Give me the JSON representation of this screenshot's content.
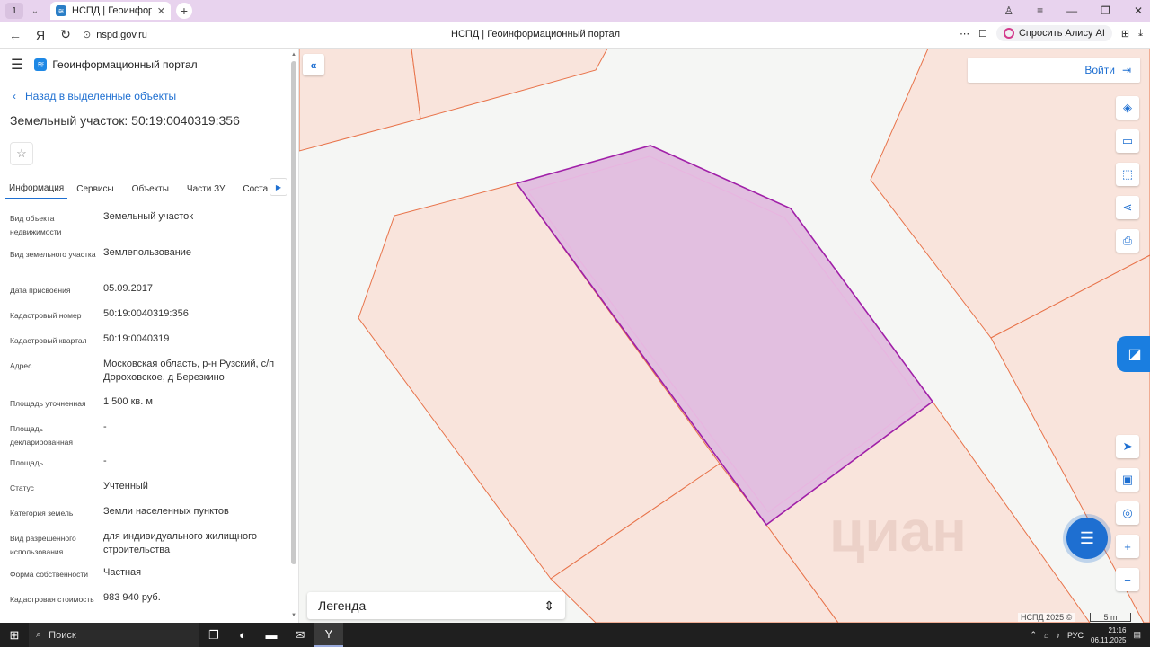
{
  "browser": {
    "tab_count": "1",
    "tab_title": "НСПД | Геоинформацио",
    "url": "nspd.gov.ru",
    "page_title": "НСПД | Геоинформационный портал",
    "alisa_label": "Спросить Алису AI"
  },
  "panel": {
    "portal_name": "Геоинформационный портал",
    "back_link": "Назад в выделенные объекты",
    "object_title": "Земельный участок: 50:19:0040319:356",
    "tabs": [
      "Информация",
      "Сервисы",
      "Объекты",
      "Части ЗУ",
      "Соста"
    ],
    "properties": [
      {
        "key": "Вид объекта недвижимости",
        "value": "Земельный участок"
      },
      {
        "key": "Вид земельного участка",
        "value": "Землепользование"
      },
      {
        "key": "Дата присвоения",
        "value": "05.09.2017"
      },
      {
        "key": "Кадастровый номер",
        "value": "50:19:0040319:356"
      },
      {
        "key": "Кадастровый квартал",
        "value": "50:19:0040319"
      },
      {
        "key": "Адрес",
        "value": "Московская область, р-н Рузский, с/п Дороховское, д Березкино"
      },
      {
        "key": "Площадь уточненная",
        "value": "1 500 кв. м"
      },
      {
        "key": "Площадь декларированная",
        "value": "-"
      },
      {
        "key": "Площадь",
        "value": "-"
      },
      {
        "key": "Статус",
        "value": "Учтенный"
      },
      {
        "key": "Категория земель",
        "value": "Земли населенных пунктов"
      },
      {
        "key": "Вид разрешенного использования",
        "value": "для индивидуального жилищного строительства"
      },
      {
        "key": "Форма собственности",
        "value": "Частная"
      },
      {
        "key": "Кадастровая стоимость",
        "value": "983 940 руб."
      }
    ]
  },
  "map": {
    "login_label": "Войти",
    "legend_label": "Легенда",
    "copyright": "НСПД 2025 ©",
    "scale_label": "5 m",
    "watermark": "циан",
    "parcel_fill": "#e2bfe0",
    "parcel_stroke": "#a020a8",
    "neighbour_fill": "#f9e4dc",
    "neighbour_stroke": "#e8734a"
  },
  "taskbar": {
    "search_placeholder": "Поиск",
    "lang": "РУС",
    "time": "21:16",
    "date": "06.11.2025"
  }
}
